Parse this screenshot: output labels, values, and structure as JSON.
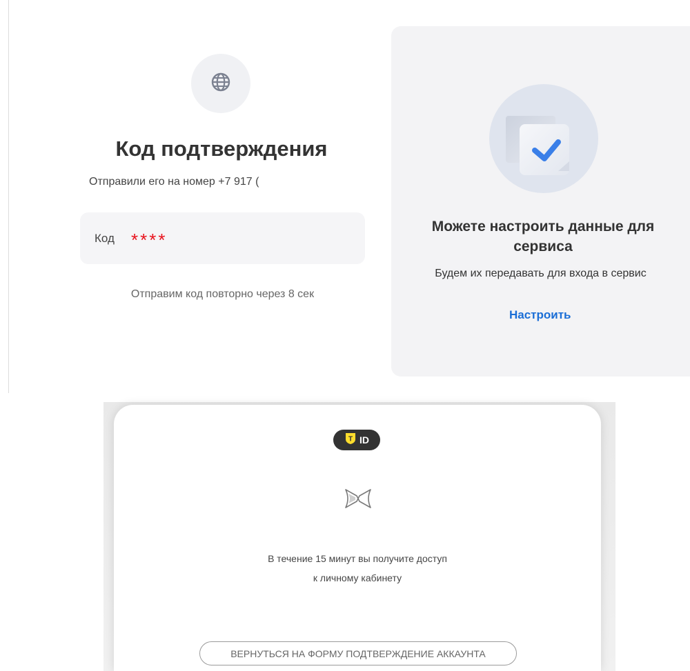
{
  "confirmation": {
    "title": "Код подтверждения",
    "sent_text": "Отправили его на номер +7 917 (",
    "code_label": "Код",
    "code_value": "****",
    "resend_text": "Отправим код повторно через 8 сек",
    "icon": "globe-icon"
  },
  "service_setup": {
    "title": "Можете настроить данные для сервиса",
    "description": "Будем их передавать для входа в сервис",
    "link_label": "Настроить",
    "icon": "checkmark-icon"
  },
  "access_dialog": {
    "brand_badge": "ID",
    "brand_letter": "T",
    "message_line1": "В течение 15 минут вы получите доступ",
    "message_line2": "к личному кабинету",
    "back_button_label": "ВЕРНУТЬСЯ НА ФОРМУ ПОДТВЕРЖДЕНИЕ АККАУНТА",
    "icon": "ribbon-icon"
  },
  "colors": {
    "accent_link": "#1b6ed6",
    "code_mask": "#e8141e",
    "brand_yellow": "#ffdd2d",
    "check_blue": "#3a7fe8"
  }
}
